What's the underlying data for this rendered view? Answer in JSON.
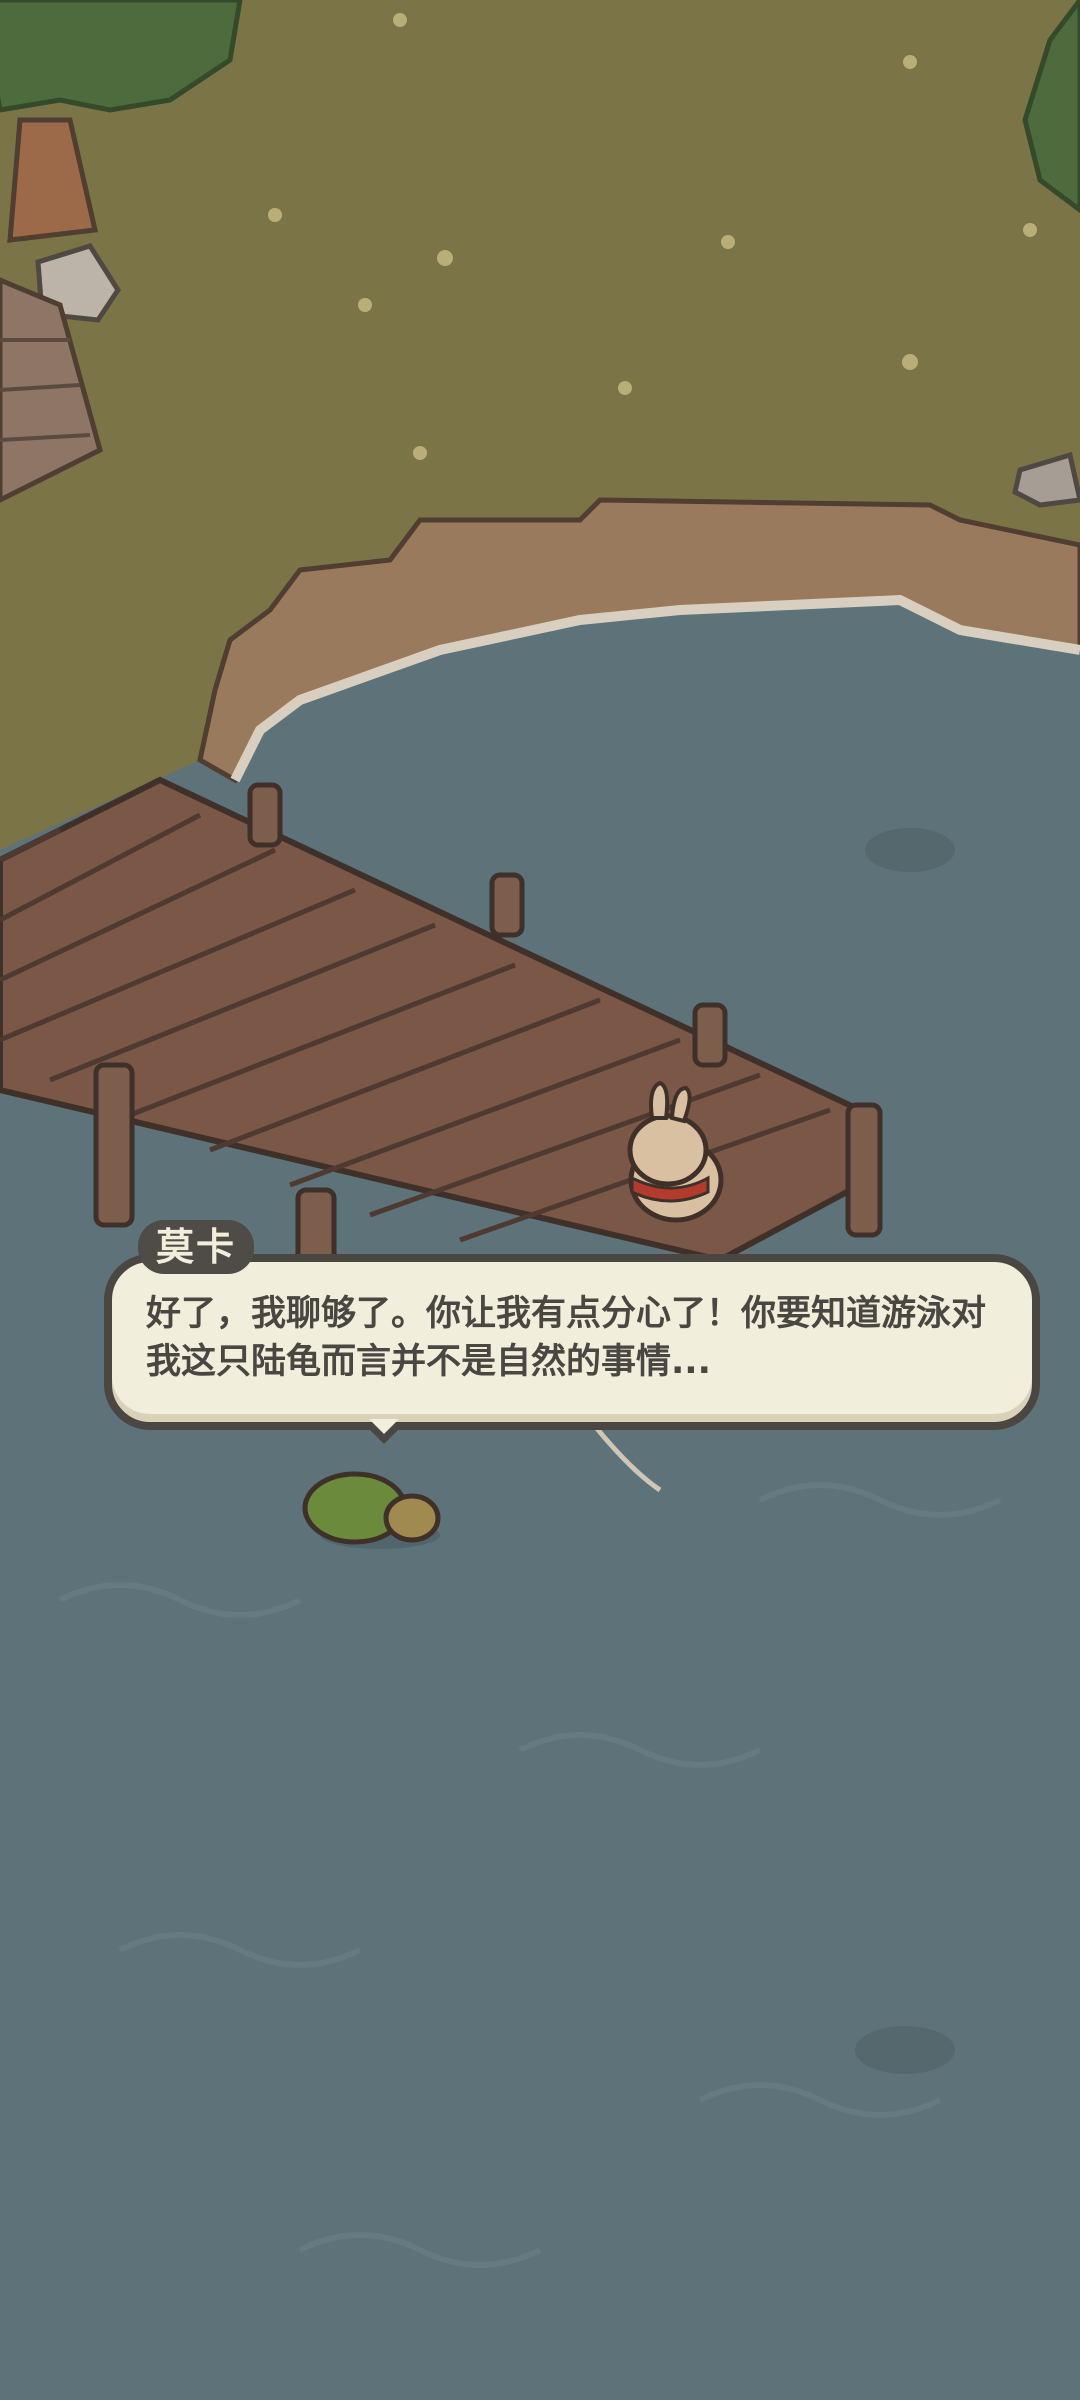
{
  "dialog": {
    "speaker": "莫卡",
    "text": "好了，我聊够了。你让我有点分心了！你要知道游泳对我这只陆龟而言并不是自然的事情..."
  },
  "colors": {
    "grass": "#7b7446",
    "water": "#5d7279",
    "dock_wood": "#7a5747",
    "dialog_bg": "#f2eedc",
    "dialog_border": "#4a4642"
  },
  "icons": {
    "character_rabbit": "rabbit-character-icon",
    "character_turtle": "turtle-character-icon"
  }
}
